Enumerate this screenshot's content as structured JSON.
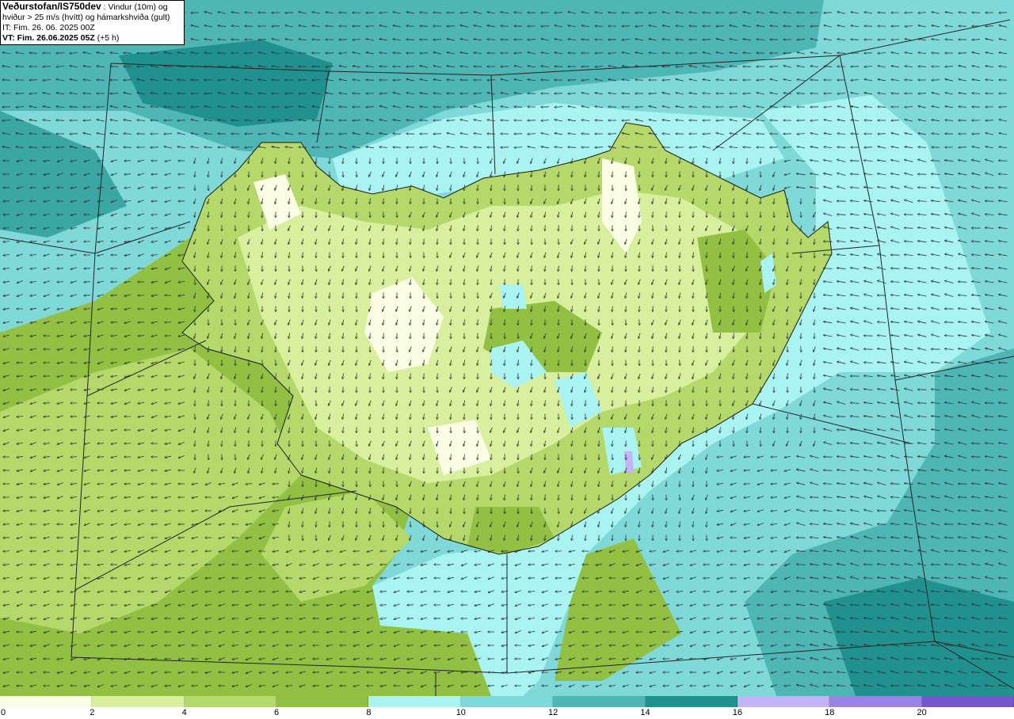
{
  "title": {
    "source": "Veðurstofan/IS750dev",
    "description_1": " : Vindur (10m) og",
    "description_2": "hviður > 25 m/s (hvítt) og hámarkshviða (gult)",
    "initial_time": "IT: Fim. 26. 06. 2025 00Z",
    "valid_time": "VT: Fim. 26.06.2025 05Z",
    "lead_time": " (+5 h)"
  },
  "legend": {
    "unit": "m/s",
    "bins": [
      {
        "from": 0,
        "to": 2,
        "color": "#fbfde4"
      },
      {
        "from": 2,
        "to": 4,
        "color": "#d8ef9e"
      },
      {
        "from": 4,
        "to": 6,
        "color": "#b4d96a"
      },
      {
        "from": 6,
        "to": 8,
        "color": "#92c043"
      },
      {
        "from": 8,
        "to": 10,
        "color": "#a9f3f3"
      },
      {
        "from": 10,
        "to": 12,
        "color": "#80d9d9"
      },
      {
        "from": 12,
        "to": 14,
        "color": "#4fb6b6"
      },
      {
        "from": 14,
        "to": 16,
        "color": "#21918f"
      },
      {
        "from": 16,
        "to": 18,
        "color": "#c4b3f6"
      },
      {
        "from": 18,
        "to": 20,
        "color": "#9c82e4"
      },
      {
        "from": 20,
        "to": 22,
        "color": "#7556cc"
      }
    ],
    "tick_labels": [
      "0",
      "2",
      "4",
      "6",
      "8",
      "10",
      "12",
      "14",
      "16",
      "18",
      "20"
    ]
  },
  "map": {
    "region": "Iceland",
    "sea_colors": {
      "calm": "#a9f3f3",
      "moderate": "#80d9d9",
      "strong": "#4fb6b6",
      "strongest": "#21918f"
    },
    "land_colors": {
      "lightest": "#fbfde4",
      "light": "#d8ef9e",
      "medium": "#b4d96a",
      "dark": "#92c043"
    },
    "arrow_color": "#333333",
    "coastline_color": "#1a1a1a"
  }
}
